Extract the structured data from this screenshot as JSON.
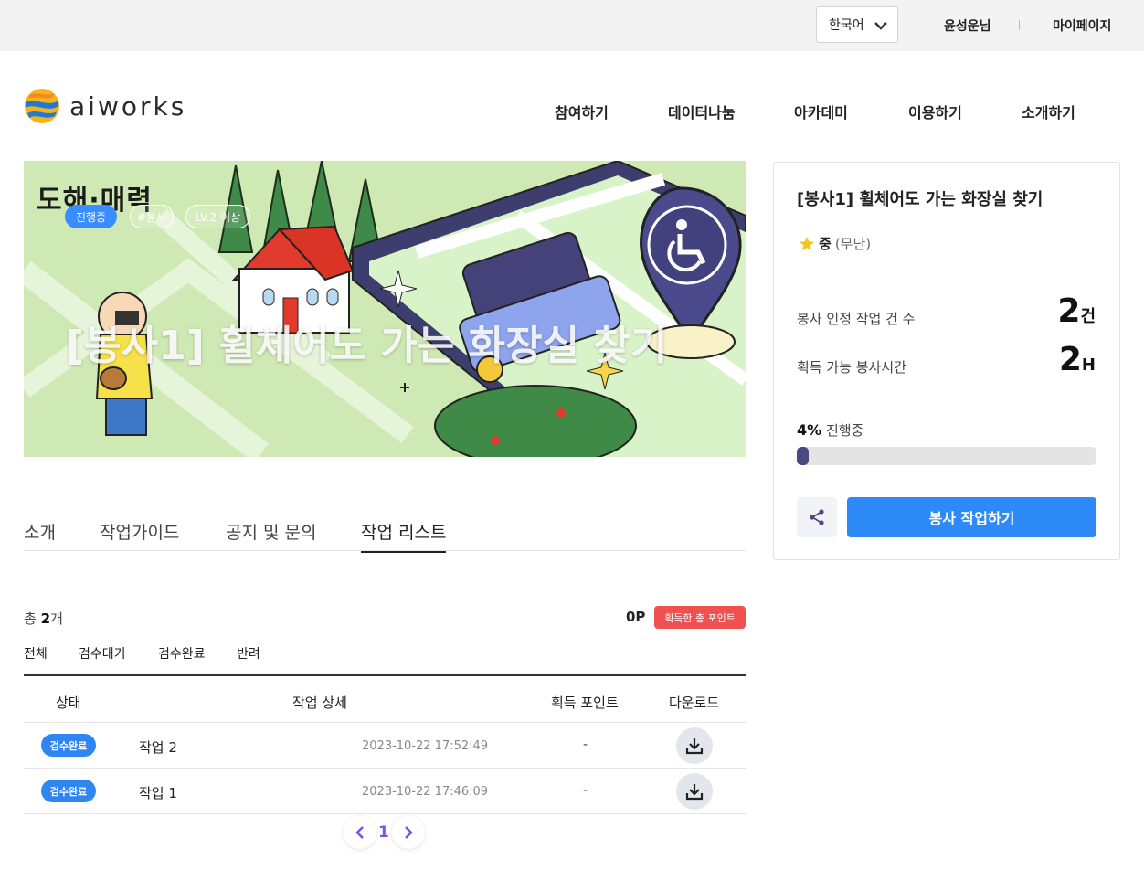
{
  "topbar": {
    "language": "한국어",
    "user": "윤성운님",
    "mypage": "마이페이지"
  },
  "header": {
    "logo_text": "aiworks",
    "nav": [
      "참여하기",
      "데이터나눔",
      "아카데미",
      "이용하기",
      "소개하기"
    ]
  },
  "banner": {
    "chips": [
      "진행중",
      "#봉사",
      "LV.2 이상"
    ],
    "title": "[봉사1] 휠체어도 가는 화장실 찾기",
    "art_text": "도해·매력"
  },
  "tabs": [
    {
      "label": "소개",
      "active": false
    },
    {
      "label": "작업가이드",
      "active": false
    },
    {
      "label": "공지 및 문의",
      "active": false
    },
    {
      "label": "작업 리스트",
      "active": true
    }
  ],
  "list": {
    "total_prefix": "총 ",
    "total_count": "2",
    "total_suffix": "개",
    "points": "0P",
    "points_badge": "획득한 총 포인트",
    "filters": [
      "전체",
      "검수대기",
      "검수완료",
      "반려"
    ],
    "columns": [
      "상태",
      "작업 상세",
      "획득 포인트",
      "다운로드"
    ],
    "rows": [
      {
        "status": "검수완료",
        "task": "작업 2",
        "date": "2023-10-22 17:52:49",
        "points": "-"
      },
      {
        "status": "검수완료",
        "task": "작업 1",
        "date": "2023-10-22 17:46:09",
        "points": "-"
      }
    ],
    "page": "1"
  },
  "card": {
    "title": "[봉사1] 휠체어도 가는 화장실 찾기",
    "difficulty": "중",
    "difficulty_note": "(무난)",
    "work_count_label": "봉사 인정 작업 건 수",
    "work_count": "2",
    "work_count_unit": "건",
    "hours_label": "획득 가능 봉사시간",
    "hours": "2",
    "hours_unit": "H",
    "progress_percent": "4%",
    "progress_label": "진행중",
    "progress_value": 0.04,
    "cta": "봉사 작업하기"
  },
  "colors": {
    "accent": "#2e8af7",
    "badge_red": "#ef5050",
    "progress": "#4a4a80"
  }
}
